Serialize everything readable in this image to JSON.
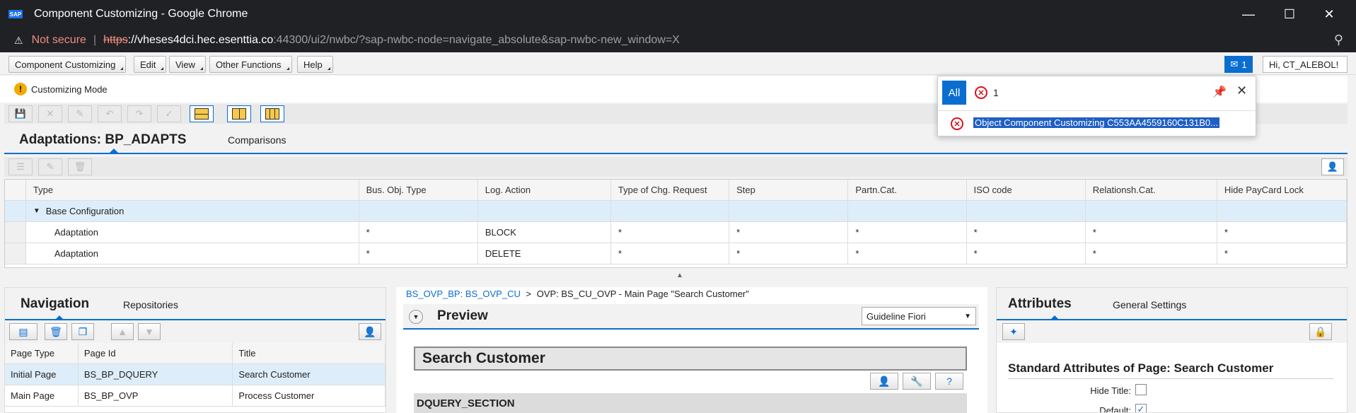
{
  "browser": {
    "title": "Component Customizing - Google Chrome",
    "logo_text": "SAP",
    "security_warning": "Not secure",
    "url_scheme": "https",
    "url_host": "://vheses4dci.hec.esenttia.co",
    "url_rest": ":44300/ui2/nwbc/?sap-nwbc-node=navigate_absolute&sap-nwbc-new_window=X"
  },
  "menu": {
    "items": [
      "Component Customizing",
      "Edit",
      "View",
      "Other Functions",
      "Help"
    ],
    "notification_count": "1",
    "greeting": "Hi, CT_ALEBOL!"
  },
  "mode": {
    "label": "Customizing Mode"
  },
  "adaptations": {
    "title": "Adaptations: BP_ADAPTS",
    "comparisons_tab": "Comparisons",
    "columns": [
      "Type",
      "Bus. Obj. Type",
      "Log. Action",
      "Type of Chg. Request",
      "Step",
      "Partn.Cat.",
      "ISO code",
      "Relationsh.Cat.",
      "Hide PayCard Lock"
    ],
    "rows": [
      {
        "type": "Base Configuration",
        "cells": [
          "",
          "",
          "",
          "",
          "",
          "",
          "",
          ""
        ]
      },
      {
        "type": "Adaptation",
        "cells": [
          "*",
          "BLOCK",
          "*",
          "*",
          "*",
          "*",
          "*",
          "*"
        ]
      },
      {
        "type": "Adaptation",
        "cells": [
          "*",
          "DELETE",
          "*",
          "*",
          "*",
          "*",
          "*",
          "*"
        ]
      }
    ]
  },
  "navigation": {
    "title": "Navigation",
    "repositories_tab": "Repositories",
    "columns": [
      "Page Type",
      "Page Id",
      "Title"
    ],
    "rows": [
      {
        "page_type": "Initial Page",
        "page_id": "BS_BP_DQUERY",
        "title": "Search Customer"
      },
      {
        "page_type": "Main Page",
        "page_id": "BS_BP_OVP",
        "title": "Process Customer"
      }
    ]
  },
  "preview": {
    "breadcrumb_link": "BS_OVP_BP: BS_OVP_CU",
    "breadcrumb_sep": ">",
    "breadcrumb_rest": "OVP: BS_CU_OVP - Main Page \"Search Customer\"",
    "title": "Preview",
    "guideline": "Guideline Fiori",
    "page_heading": "Search Customer",
    "section": "DQUERY_SECTION"
  },
  "attributes": {
    "title": "Attributes",
    "general_tab": "General Settings",
    "section_title": "Standard Attributes of Page: Search Customer",
    "hide_title_label": "Hide Title:",
    "default_label": "Default:"
  },
  "popover": {
    "all_label": "All",
    "error_count": "1",
    "message": "Object Component Customizing C553AA4559160C131B0..."
  }
}
